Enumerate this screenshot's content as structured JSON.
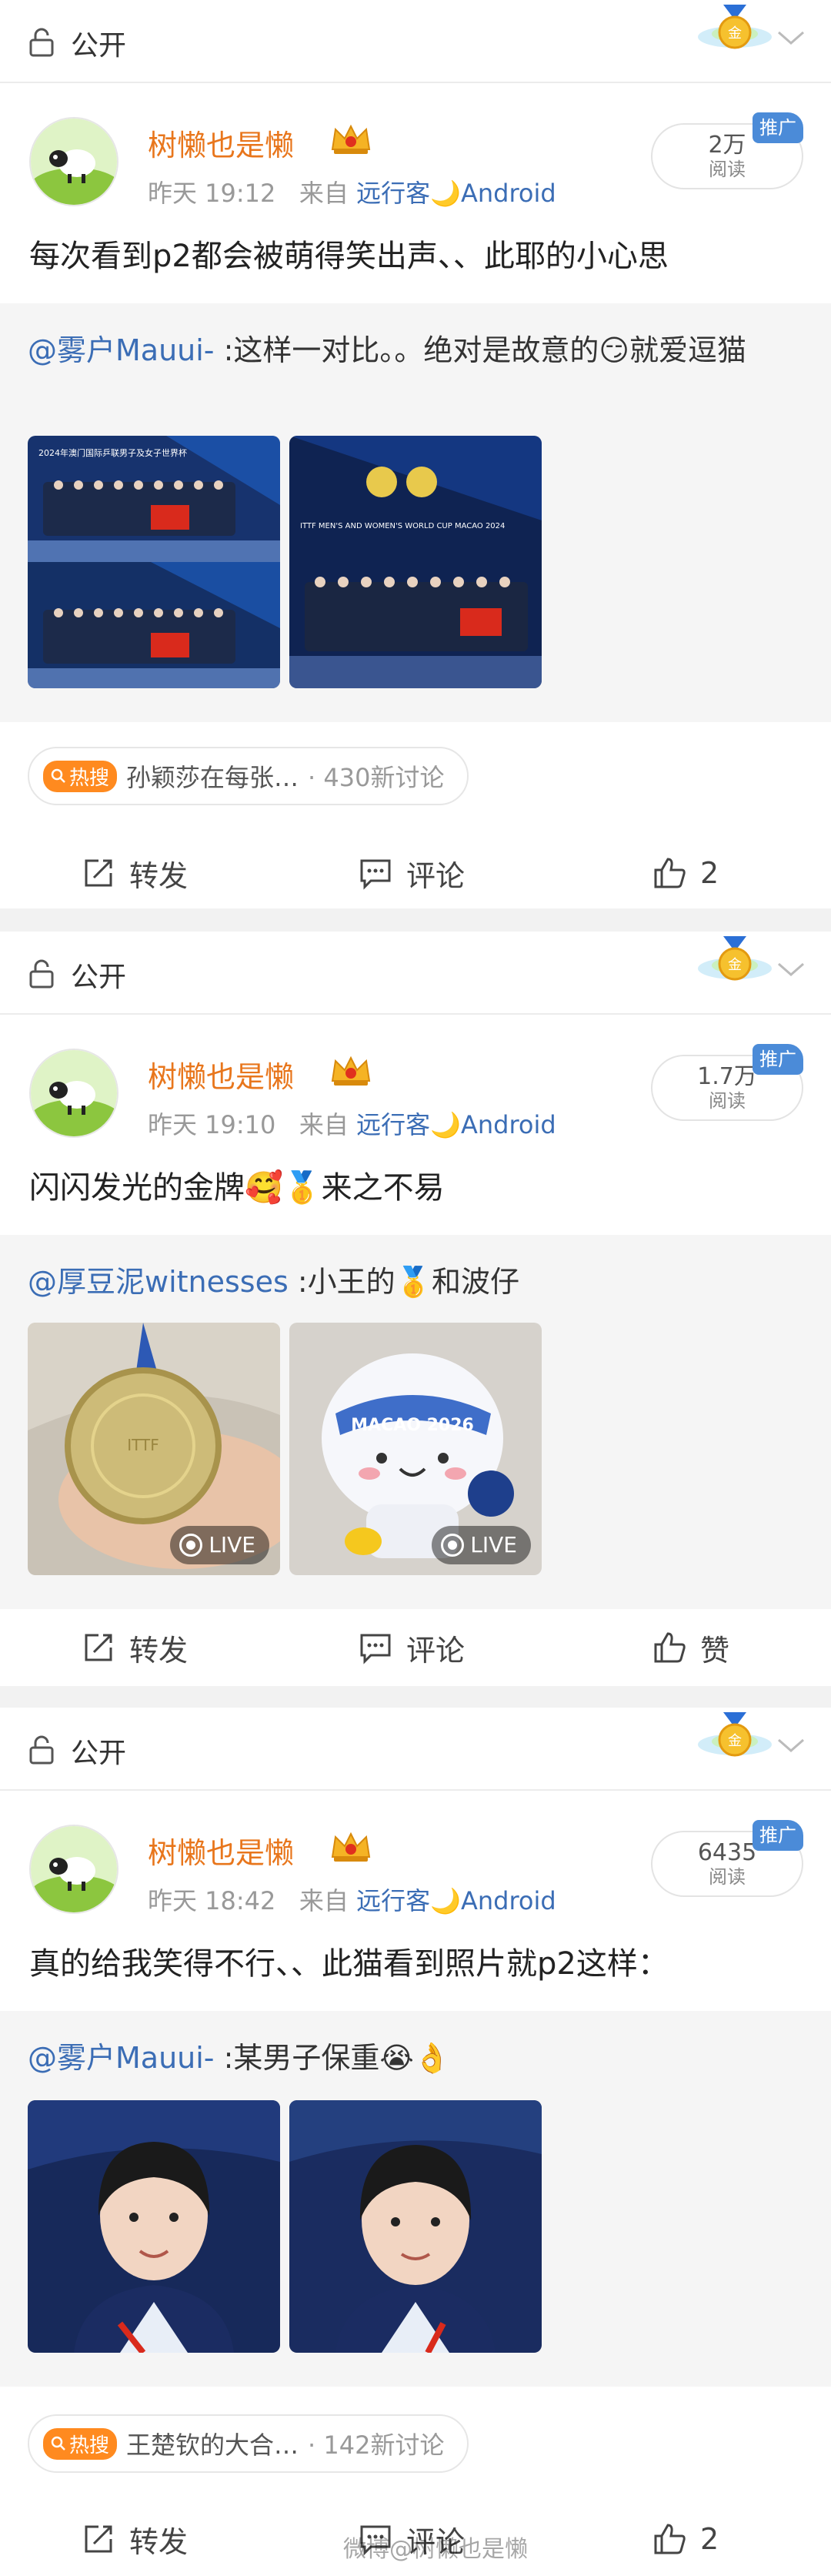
{
  "posts": [
    {
      "visibility": "公开",
      "username": "树懒也是懒",
      "time": "昨天 19:12",
      "from_label": "来自",
      "source": "远行客🌙Android",
      "reads": "2万",
      "reads_label": "阅读",
      "promo": "推广",
      "text": "每次看到p2都会被萌得笑出声、、此耶的小心思",
      "quote": {
        "mention": "@雾户Mauui-",
        "text": " :这样一对比。。绝对是故意的😏就爱逗猫"
      },
      "hot_tag": {
        "badge": "热搜",
        "title": "孙颖莎在每张…",
        "sub": "· 430新讨论"
      },
      "actions": {
        "repost": "转发",
        "comment": "评论",
        "like": "2"
      }
    },
    {
      "visibility": "公开",
      "username": "树懒也是懒",
      "time": "昨天 19:10",
      "from_label": "来自",
      "source": "远行客🌙Android",
      "reads": "1.7万",
      "reads_label": "阅读",
      "promo": "推广",
      "text": "闪闪发光的金牌🥰🥇来之不易",
      "quote": {
        "mention": "@厚豆泥witnesses",
        "text": " :小王的🥇和波仔"
      },
      "live_label": "LIVE",
      "actions": {
        "repost": "转发",
        "comment": "评论",
        "like": "赞"
      }
    },
    {
      "visibility": "公开",
      "username": "树懒也是懒",
      "time": "昨天 18:42",
      "from_label": "来自",
      "source": "远行客🌙Android",
      "reads": "6435",
      "reads_label": "阅读",
      "promo": "推广",
      "text": "真的给我笑得不行、、此猫看到照片就p2这样：",
      "quote": {
        "mention": "@雾户Mauui-",
        "text": " :某男子保重😭👌"
      },
      "hot_tag": {
        "badge": "热搜",
        "title": "王楚钦的大合…",
        "sub": "· 142新讨论"
      },
      "actions": {
        "repost": "转发",
        "comment": "评论",
        "like": "2"
      }
    }
  ],
  "images": {
    "post1": [
      {
        "caption": "2024年澳门国际乒联男子及女子世界杯"
      },
      {
        "caption": "ITTF MEN'S AND WOMEN'S WORLD CUP MACAO 2024"
      }
    ],
    "post2": [
      {
        "caption": ""
      },
      {
        "caption": "MACAO 2026"
      }
    ]
  },
  "watermark": "微博@树懒也是懒",
  "colors": {
    "accent": "#e8761c",
    "link": "#3b6db5",
    "promo": "#4b8bd8",
    "hot": "#ff8a1f"
  }
}
